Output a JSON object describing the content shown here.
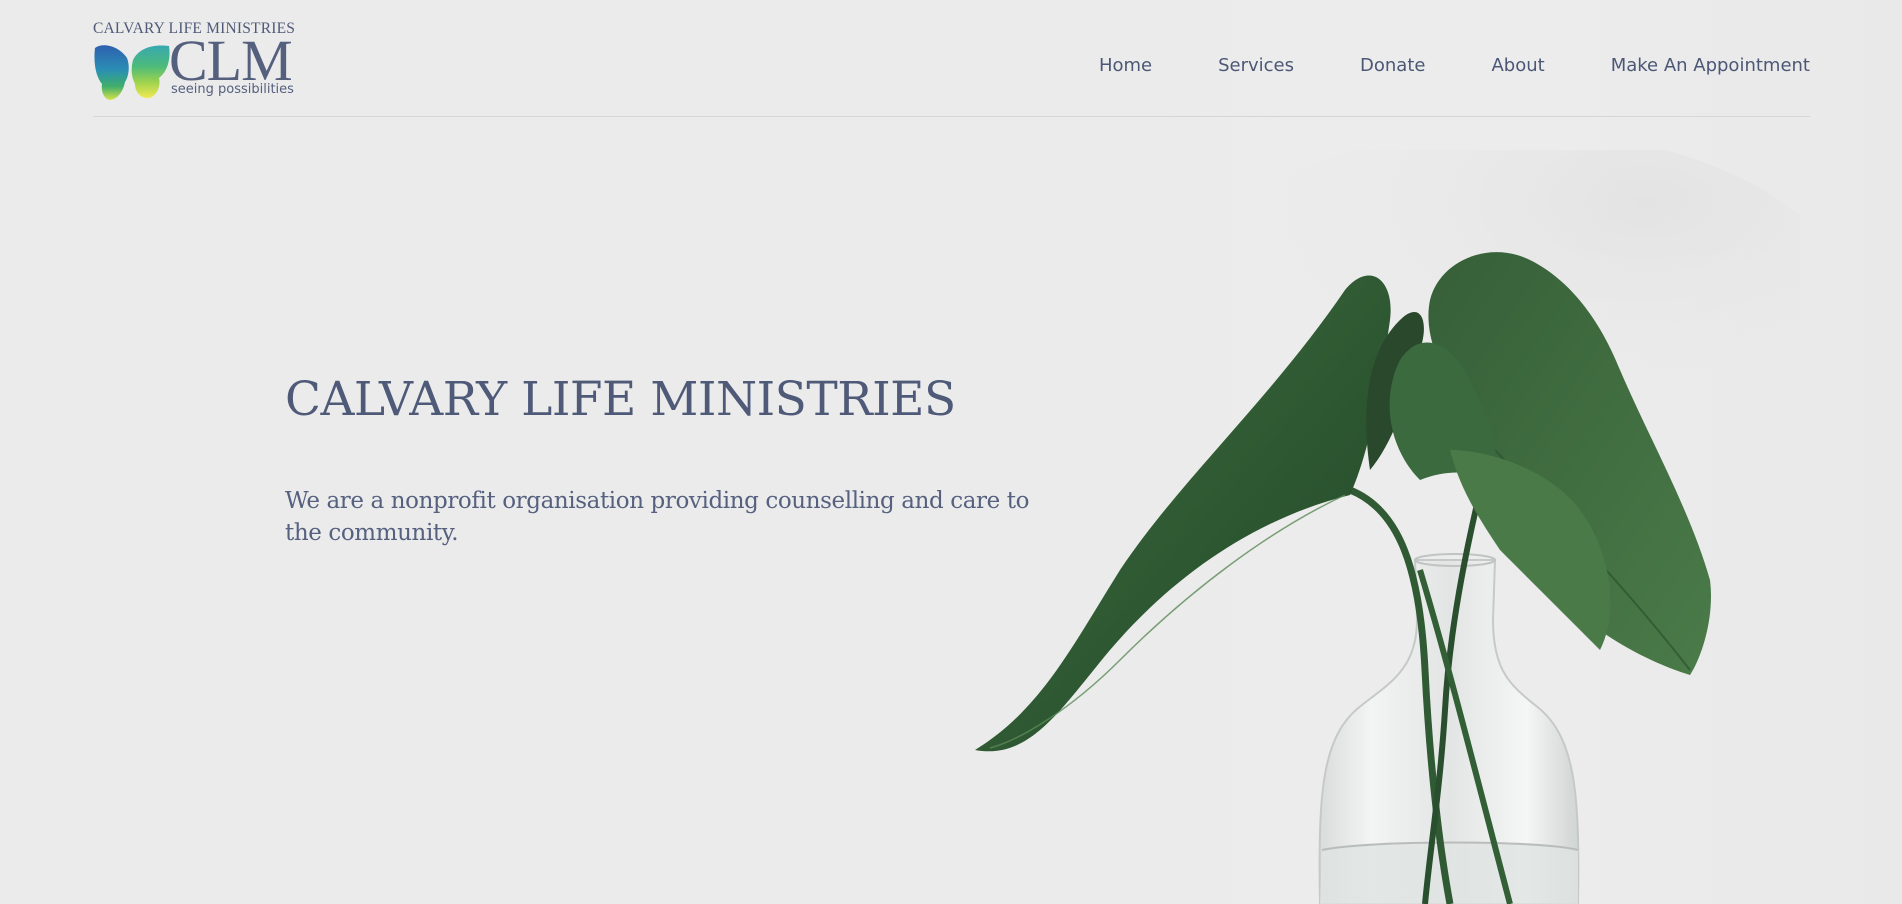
{
  "brand": {
    "top_text": "CALVARY LIFE MINISTRIES",
    "acronym": "CLM",
    "tagline": "seeing possibilities"
  },
  "nav": {
    "items": [
      {
        "label": "Home"
      },
      {
        "label": "Services"
      },
      {
        "label": "Donate"
      },
      {
        "label": "About"
      },
      {
        "label": "Make An Appointment"
      }
    ]
  },
  "hero": {
    "title": "CALVARY LIFE MINISTRIES",
    "subtitle": "We are a nonprofit organisation providing counselling and care to the community."
  },
  "colors": {
    "background": "#ebebeb",
    "text_primary": "#4f5a78",
    "leaf_dark": "#2f5a33",
    "leaf_light": "#4c7e4a"
  },
  "icons": {
    "logo_mark": "butterfly-icon",
    "hero_image": "plant-in-vase-image"
  }
}
